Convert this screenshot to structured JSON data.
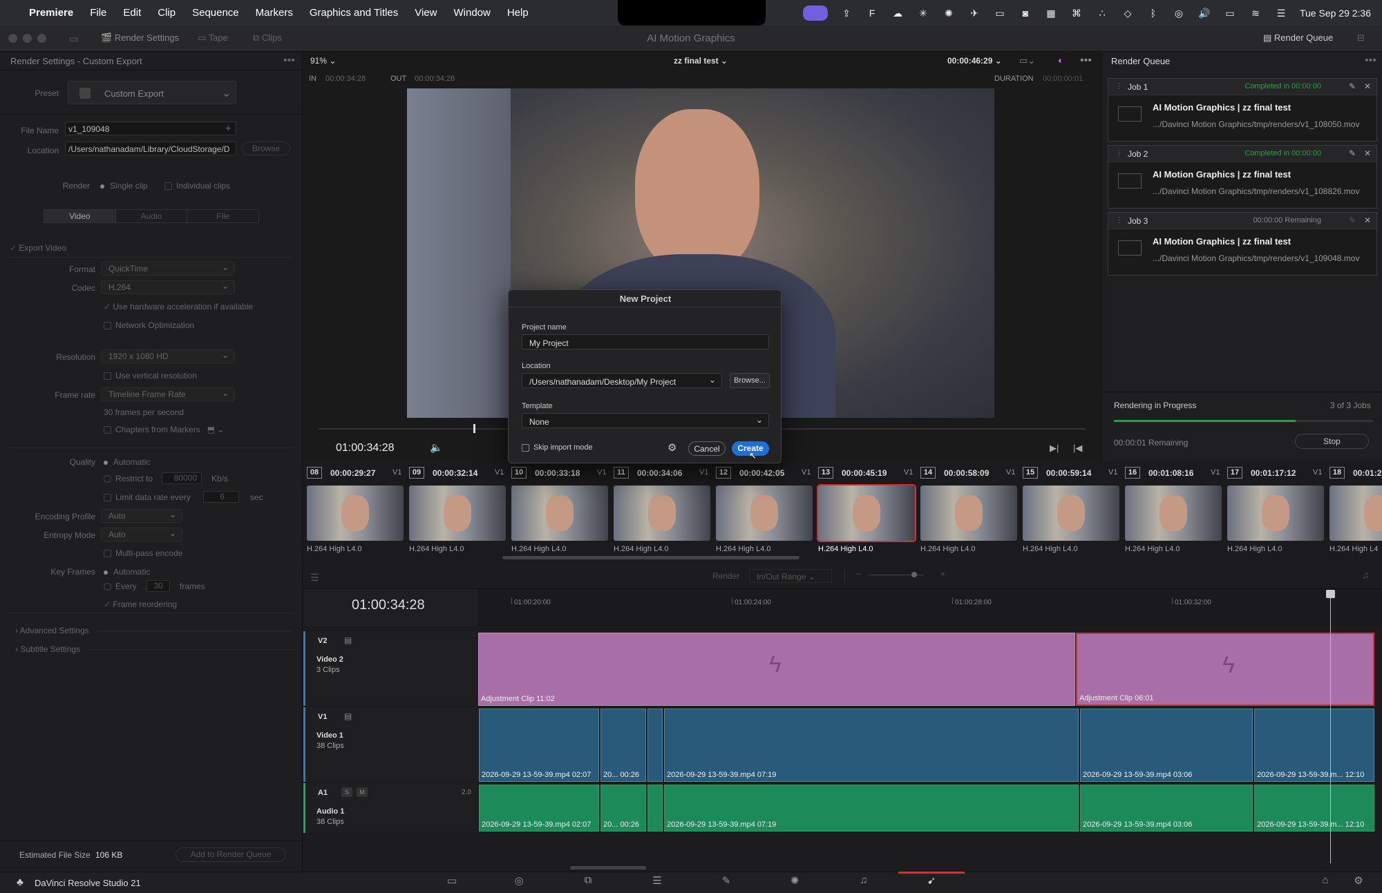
{
  "menubar": {
    "app": "Premiere",
    "items": [
      "File",
      "Edit",
      "Clip",
      "Sequence",
      "Markers",
      "Graphics and Titles",
      "View",
      "Window",
      "Help"
    ],
    "clock": "Tue Sep 29  2:36"
  },
  "titlebar": {
    "title": "AI Motion Graphics",
    "render_settings": "Render Settings",
    "tape": "Tape",
    "clips": "Clips",
    "render_queue": "Render Queue"
  },
  "left": {
    "header": "Render Settings - Custom Export",
    "preset_label": "Preset",
    "preset": "Custom Export",
    "file_name_label": "File Name",
    "file_name": "v1_109048",
    "location_label": "Location",
    "location": "/Users/nathanadam/Library/CloudStorage/D",
    "browse": "Browse",
    "render_label": "Render",
    "single_clip": "Single clip",
    "individual_clips": "Individual clips",
    "tab_video": "Video",
    "tab_audio": "Audio",
    "tab_file": "File",
    "export_video": "Export Video",
    "format_label": "Format",
    "format": "QuickTime",
    "codec_label": "Codec",
    "codec": "H.264",
    "hw_accel": "Use hardware acceleration if available",
    "net_opt": "Network Optimization",
    "resolution_label": "Resolution",
    "resolution": "1920 x 1080 HD",
    "vertical": "Use vertical resolution",
    "framerate_label": "Frame rate",
    "framerate": "Timeline Frame Rate",
    "fps": "30 frames per second",
    "chapters": "Chapters from Markers",
    "quality_label": "Quality",
    "automatic": "Automatic",
    "restrict": "Restrict to",
    "restrict_val": "80000",
    "kbs": "Kb/s",
    "limit": "Limit data rate every",
    "limit_val": "6",
    "sec": "sec",
    "enc_profile_label": "Encoding Profile",
    "enc_profile": "Auto",
    "entropy_label": "Entropy Mode",
    "entropy": "Auto",
    "multipass": "Multi-pass encode",
    "keyframes_label": "Key Frames",
    "kf_auto": "Automatic",
    "every": "Every",
    "every_val": "30",
    "frames": "frames",
    "reorder": "Frame reordering",
    "advanced": "Advanced Settings",
    "subtitle": "Subtitle Settings",
    "est_label": "Estimated File Size",
    "est_val": "106 KB",
    "add_queue": "Add to Render Queue"
  },
  "viewer": {
    "zoom": "91%",
    "timeline": "zz final test",
    "timecode": "00:00:46:29",
    "in_label": "IN",
    "in": "00:00:34:28",
    "out_label": "OUT",
    "out": "00:00:34:28",
    "duration_label": "DURATION",
    "duration": "00:00:00:01",
    "current_tc": "01:00:34:28"
  },
  "queue": {
    "header": "Render Queue",
    "jobs": [
      {
        "name": "Job 1",
        "status": "Completed in 00:00:00",
        "title": "AI Motion Graphics | zz final test",
        "path": ".../Davinci Motion Graphics/tmp/renders/v1_108050.mov"
      },
      {
        "name": "Job 2",
        "status": "Completed in 00:00:00",
        "title": "AI Motion Graphics | zz final test",
        "path": ".../Davinci Motion Graphics/tmp/renders/v1_108826.mov"
      },
      {
        "name": "Job 3",
        "status": "00:00:00 Remaining",
        "title": "AI Motion Graphics | zz final test",
        "path": ".../Davinci Motion Graphics/tmp/renders/v1_109048.mov"
      }
    ],
    "progress_label": "Rendering in Progress",
    "progress_count": "3 of 3 Jobs",
    "progress": 0.7,
    "remaining": "00:00:01 Remaining",
    "stop": "Stop"
  },
  "clips": [
    {
      "num": "08",
      "tc": "00:00:29:27",
      "track": "V1",
      "codec": "H.264 High L4.0"
    },
    {
      "num": "09",
      "tc": "00:00:32:14",
      "track": "V1",
      "codec": "H.264 High L4.0"
    },
    {
      "num": "10",
      "tc": "00:00:33:18",
      "track": "V1",
      "codec": "H.264 High L4.0"
    },
    {
      "num": "11",
      "tc": "00:00:34:06",
      "track": "V1",
      "codec": "H.264 High L4.0"
    },
    {
      "num": "12",
      "tc": "00:00:42:05",
      "track": "V1",
      "codec": "H.264 High L4.0"
    },
    {
      "num": "13",
      "tc": "00:00:45:19",
      "track": "V1",
      "codec": "H.264 High L4.0"
    },
    {
      "num": "14",
      "tc": "00:00:58:09",
      "track": "V1",
      "codec": "H.264 High L4.0"
    },
    {
      "num": "15",
      "tc": "00:00:59:14",
      "track": "V1",
      "codec": "H.264 High L4.0"
    },
    {
      "num": "16",
      "tc": "00:01:08:16",
      "track": "V1",
      "codec": "H.264 High L4.0"
    },
    {
      "num": "17",
      "tc": "00:01:17:12",
      "track": "V1",
      "codec": "H.264 High L4.0"
    },
    {
      "num": "18",
      "tc": "00:01:2",
      "track": "",
      "codec": "H.264 High L4"
    }
  ],
  "timeline": {
    "render_label": "Render",
    "render_mode": "In/Out Range",
    "tc": "01:00:34:28",
    "ruler": [
      "01:00:20:00",
      "01:00:24:00",
      "01:00:28:00",
      "01:00:32:00"
    ],
    "v2": {
      "id": "V2",
      "name": "Video 2",
      "count": "3 Clips",
      "clip1": "Adjustment Clip  11:02",
      "clip2": "Adjustment Clip  06:01"
    },
    "v1": {
      "id": "V1",
      "name": "Video 1",
      "count": "38 Clips",
      "c1": "2026-09-29 13-59-39.mp4  02:07",
      "c2": "20...   00:26",
      "c3": "2026-09-29 13-59-39.mp4  07:19",
      "c4": "2026-09-29 13-59-39.mp4  03:06",
      "c5": "2026-09-29 13-59-39.m...  12:10"
    },
    "a1": {
      "id": "A1",
      "name": "Audio 1",
      "count": "38 Clips",
      "level": "2.0",
      "s": "S",
      "m": "M"
    }
  },
  "dialog": {
    "title": "New Project",
    "name_label": "Project name",
    "name": "My Project",
    "location_label": "Location",
    "location": "/Users/nathanadam/Desktop/My Project",
    "browse": "Browse...",
    "template_label": "Template",
    "template": "None",
    "skip": "Skip import mode",
    "cancel": "Cancel",
    "create": "Create"
  },
  "footer": {
    "app": "DaVinci Resolve Studio 21"
  },
  "colors": {
    "accent": "#1e6fd9",
    "purple": "#a86ea8",
    "green_status": "#2aa040"
  }
}
